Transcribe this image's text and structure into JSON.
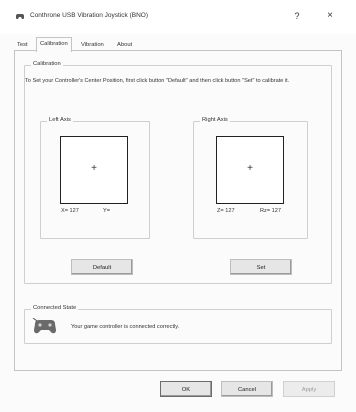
{
  "window": {
    "title": "Conthrone USB Vibration Joystick (BNO)",
    "help_glyph": "?",
    "close_glyph": "×",
    "title_icon": "gamepad-icon"
  },
  "tabs": [
    {
      "label": "Test",
      "active": false
    },
    {
      "label": "Calibration",
      "active": true
    },
    {
      "label": "Vibration",
      "active": false
    },
    {
      "label": "About",
      "active": false
    }
  ],
  "calibration": {
    "group_label": "Calibration",
    "instruction": "To Set your Controller's Center Position, first click button \"Default\" and then click button \"Set\" to calibrate it.",
    "left_axis": {
      "label": "Left Axis",
      "crosshair": "+",
      "x_text": "X= 127",
      "y_text": "Y="
    },
    "right_axis": {
      "label": "Right Axis",
      "crosshair": "+",
      "z_text": "Z= 127",
      "rz_text": "Rz= 127"
    },
    "default_button": "Default",
    "set_button": "Set"
  },
  "connected_state": {
    "group_label": "Connected State",
    "icon": "gamepad-icon",
    "message": "Your game controller is connected correctly."
  },
  "footer": {
    "ok": "OK",
    "cancel": "Cancel",
    "apply": "Apply",
    "apply_disabled": true
  },
  "colors": {
    "window_bg": "#fbfbfb",
    "border": "#c4c4c4",
    "button_bg": "#e6e6e6",
    "disabled_text": "#9a9a9a"
  }
}
